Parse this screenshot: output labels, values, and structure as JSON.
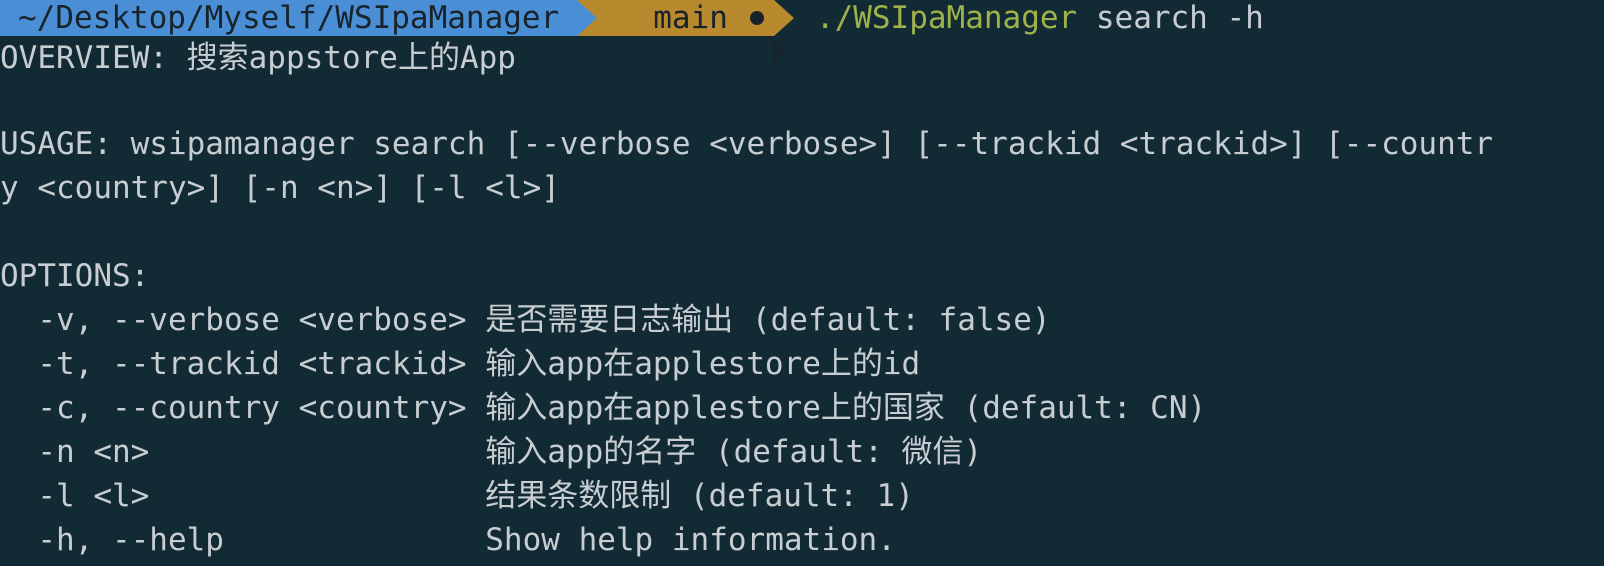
{
  "prompt": {
    "path": "~/Desktop/Myself/WSIpaManager",
    "branch": "main",
    "command_bin": "./WSIpaManager",
    "command_args": " search -h"
  },
  "output": {
    "overview": "OVERVIEW: 搜索appstore上的App",
    "usage_line1": "USAGE: wsipamanager search [--verbose <verbose>] [--trackid <trackid>] [--countr",
    "usage_line2": "y <country>] [-n <n>] [-l <l>]",
    "options_header": "OPTIONS:",
    "options": [
      "  -v, --verbose <verbose> 是否需要日志输出 (default: false)",
      "  -t, --trackid <trackid> 输入app在applestore上的id",
      "  -c, --country <country> 输入app在applestore上的国家 (default: CN)",
      "  -n <n>                  输入app的名字 (default: 微信)",
      "  -l <l>                  结果条数限制 (default: 1)",
      "  -h, --help              Show help information."
    ]
  },
  "colors": {
    "background": "#122a34",
    "path_segment": "#4a8fd6",
    "git_segment": "#b8892d",
    "command": "#9fb24a",
    "text": "#c7cdd1"
  }
}
